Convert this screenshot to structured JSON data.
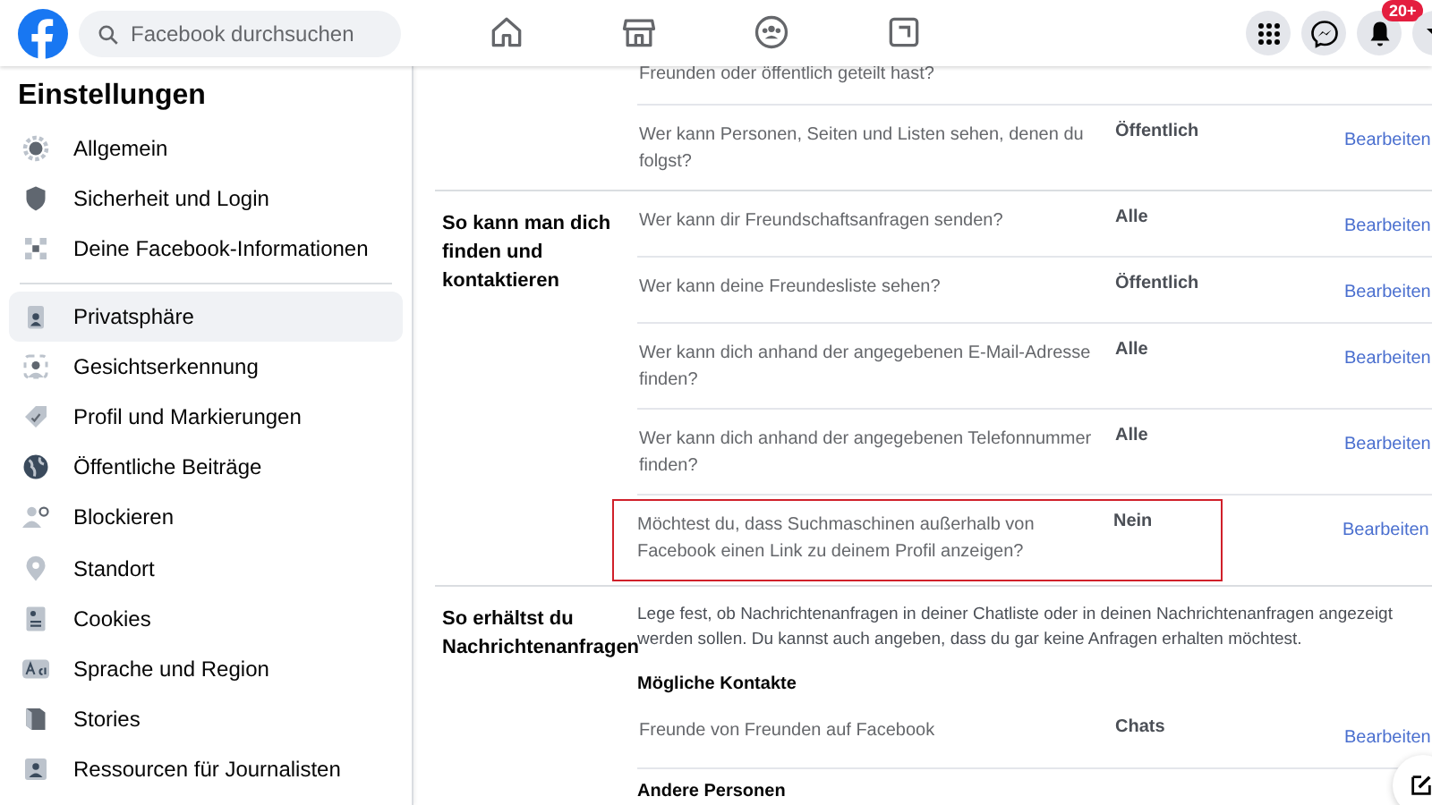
{
  "header": {
    "search": {
      "placeholder": "Facebook durchsuchen"
    },
    "nav": [
      {
        "kind": "home"
      },
      {
        "kind": "store"
      },
      {
        "kind": "groups"
      },
      {
        "kind": "gaming"
      }
    ],
    "actions": [
      {
        "kind": "grid"
      },
      {
        "kind": "messenger"
      },
      {
        "kind": "bell",
        "badge": "20+"
      },
      {
        "kind": "caret"
      }
    ]
  },
  "sidebar": {
    "title": "Einstellungen",
    "groups": [
      [
        {
          "label": "Allgemein",
          "selected": false
        },
        {
          "label": "Sicherheit und Login",
          "selected": false
        },
        {
          "label": "Deine Facebook-Informationen",
          "selected": false
        }
      ],
      [
        {
          "label": "Privatsphäre",
          "selected": true
        },
        {
          "label": "Gesichtserkennung",
          "selected": false
        },
        {
          "label": "Profil und Markierungen",
          "selected": false
        },
        {
          "label": "Öffentliche Beiträge",
          "selected": false
        },
        {
          "label": "Blockieren",
          "selected": false
        },
        {
          "label": "Standort",
          "selected": false
        },
        {
          "label": "Cookies",
          "selected": false
        },
        {
          "label": "Sprache und Region",
          "selected": false
        },
        {
          "label": "Stories",
          "selected": false
        },
        {
          "label": "Ressourcen für Journalisten",
          "selected": false
        }
      ]
    ]
  },
  "sections": [
    {
      "rows": [
        {
          "kind": "setting",
          "question": "Freunden oder öffentlich geteilt hast?",
          "highlighted": false
        },
        {
          "kind": "setting",
          "question": "Wer kann Personen, Seiten und Listen sehen, denen du folgst?",
          "value": "Öffentlich",
          "action": "Bearbeiten",
          "highlighted": false
        }
      ]
    },
    {
      "title": "So kann man dich finden und kontaktieren",
      "rows": [
        {
          "kind": "setting",
          "question": "Wer kann dir Freundschaftsanfragen senden?",
          "value": "Alle",
          "action": "Bearbeiten",
          "highlighted": false
        },
        {
          "kind": "setting",
          "question": "Wer kann deine Freundesliste sehen?",
          "value": "Öffentlich",
          "action": "Bearbeiten",
          "highlighted": false
        },
        {
          "kind": "setting",
          "question": "Wer kann dich anhand der angegebenen E-Mail-Adresse finden?",
          "value": "Alle",
          "action": "Bearbeiten",
          "highlighted": false
        },
        {
          "kind": "setting",
          "question": "Wer kann dich anhand der angegebenen Telefonnummer finden?",
          "value": "Alle",
          "action": "Bearbeiten",
          "highlighted": false
        },
        {
          "kind": "setting",
          "question": "Möchtest du, dass Suchmaschinen außerhalb von Facebook einen Link zu deinem Profil anzeigen?",
          "value": "Nein",
          "action": "Bearbeiten",
          "highlighted": true
        }
      ]
    },
    {
      "title": "So erhältst du Nachrichtenanfragen",
      "rows": [
        {
          "kind": "note",
          "text": "Lege fest, ob Nachrichtenanfragen in deiner Chatliste oder in deinen Nachrichtenanfragen angezeigt werden sollen. Du kannst auch angeben, dass du gar keine Anfragen erhalten möchtest."
        },
        {
          "kind": "subheading",
          "text": "Mögliche Kontakte"
        },
        {
          "kind": "setting",
          "question": "Freunde von Freunden auf Facebook",
          "value": "Chats",
          "action": "Bearbeiten",
          "highlighted": false
        },
        {
          "kind": "subheading",
          "text": "Andere Personen"
        }
      ]
    }
  ]
}
